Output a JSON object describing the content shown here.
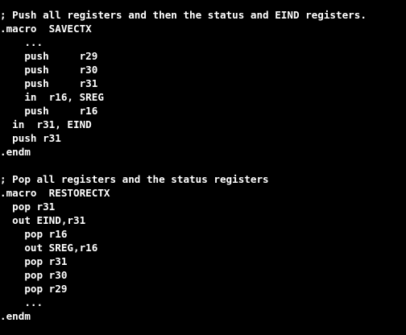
{
  "code": {
    "lines": [
      "; Push all registers and then the status and EIND registers.",
      ".macro  SAVECTX",
      "    ...",
      "    push     r29",
      "    push     r30",
      "    push     r31",
      "    in  r16, SREG",
      "    push     r16",
      "  in  r31, EIND",
      "  push r31",
      ".endm",
      "; Pop all registers and the status registers",
      ".macro  RESTORECTX",
      "  pop r31",
      "  out EIND,r31",
      "    pop r16",
      "    out SREG,r16",
      "    pop r31",
      "    pop r30",
      "    pop r29",
      "    ...",
      ".endm"
    ]
  },
  "colors": {
    "background": "#000000",
    "text": "#ffffff"
  }
}
